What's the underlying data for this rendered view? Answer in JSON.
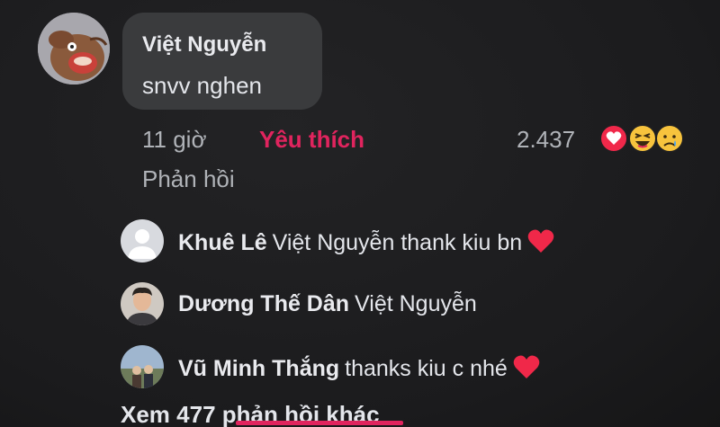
{
  "comment": {
    "author": "Việt Nguyễn",
    "text": "snvv nghen",
    "time": "11 giờ",
    "like_label": "Yêu thích",
    "reaction_count": "2.437",
    "reply_label": "Phản hồi",
    "reactions": [
      "love-reaction-icon",
      "haha-reaction-icon",
      "sad-reaction-icon"
    ]
  },
  "replies": [
    {
      "author": "Khuê Lê",
      "text": "Việt Nguyễn thank kiu bn",
      "has_heart": true
    },
    {
      "author": "Dương Thế Dân",
      "text": "Việt Nguyễn",
      "has_heart": false
    },
    {
      "author": "Vũ Minh Thắng",
      "text": "thanks kiu c nhé",
      "has_heart": true
    }
  ],
  "more_replies_label": "Xem 477 phản hồi khác",
  "colors": {
    "like_accent": "#e0245e",
    "bubble": "#3a3b3d",
    "background": "#1e1e20",
    "heart": "#f02849"
  }
}
